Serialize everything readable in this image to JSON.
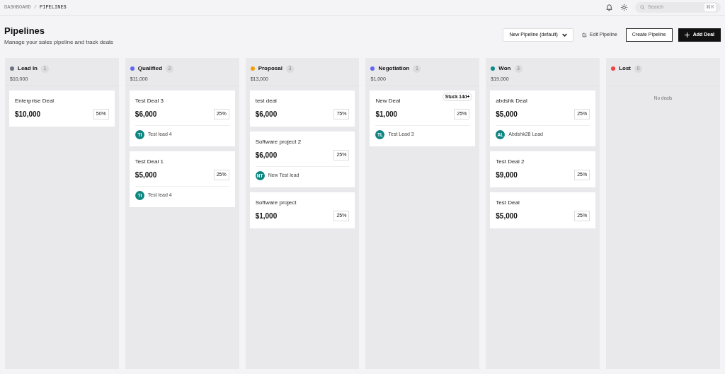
{
  "breadcrumb": [
    "DASHBOARD",
    "PIPELINES"
  ],
  "breadcrumb_separator": "/",
  "search": {
    "placeholder": "Search",
    "shortcut": "⌘K"
  },
  "header": {
    "title": "Pipelines",
    "subtitle": "Manage your sales pipeline and track deals"
  },
  "pipeline_select": {
    "value": "New Pipeline (default)"
  },
  "edit_button": "Edit Pipeline",
  "create_button": "Create Pipeline",
  "add_button": "Add Deal",
  "columns": [
    {
      "name": "Lead In",
      "count": "1",
      "total": "$10,000",
      "color": "#6b7280",
      "deals": [
        {
          "title": "Enterprise Deal",
          "amount": "$10,000",
          "probability": "50%"
        }
      ]
    },
    {
      "name": "Qualified",
      "count": "2",
      "total": "$11,000",
      "color": "#6366f1",
      "deals": [
        {
          "title": "Test Deal 3",
          "amount": "$6,000",
          "probability": "25%",
          "lead": {
            "initials": "TI",
            "name": "Test lead 4"
          }
        },
        {
          "title": "Test Deal 1",
          "amount": "$5,000",
          "probability": "25%",
          "lead": {
            "initials": "TI",
            "name": "Test lead 4"
          }
        }
      ]
    },
    {
      "name": "Proposal",
      "count": "3",
      "total": "$13,000",
      "color": "#f59e0b",
      "deals": [
        {
          "title": "test deal",
          "amount": "$6,000",
          "probability": "75%"
        },
        {
          "title": "Software project 2",
          "amount": "$6,000",
          "probability": "25%",
          "lead": {
            "initials": "NT",
            "name": "New Test lead"
          }
        },
        {
          "title": "Software project",
          "amount": "$1,000",
          "probability": "25%"
        }
      ]
    },
    {
      "name": "Negotiation",
      "count": "1",
      "total": "$1,000",
      "color": "#6366f1",
      "deals": [
        {
          "title": "New Deal",
          "amount": "$1,000",
          "probability": "25%",
          "badge": "Stuck 14d+",
          "lead": {
            "initials": "TL",
            "name": "Test Lead 3"
          }
        }
      ]
    },
    {
      "name": "Won",
      "count": "3",
      "total": "$19,000",
      "color": "#0d8a8a",
      "deals": [
        {
          "title": "abdshk Deal",
          "amount": "$5,000",
          "probability": "25%",
          "lead": {
            "initials": "AL",
            "name": "Abdshk28 Lead"
          }
        },
        {
          "title": "Test Deal 2",
          "amount": "$9,000",
          "probability": "25%"
        },
        {
          "title": "Test Deal",
          "amount": "$5,000",
          "probability": "25%"
        }
      ]
    },
    {
      "name": "Lost",
      "count": "0",
      "color": "#ef4444",
      "empty_text": "No deals"
    }
  ]
}
